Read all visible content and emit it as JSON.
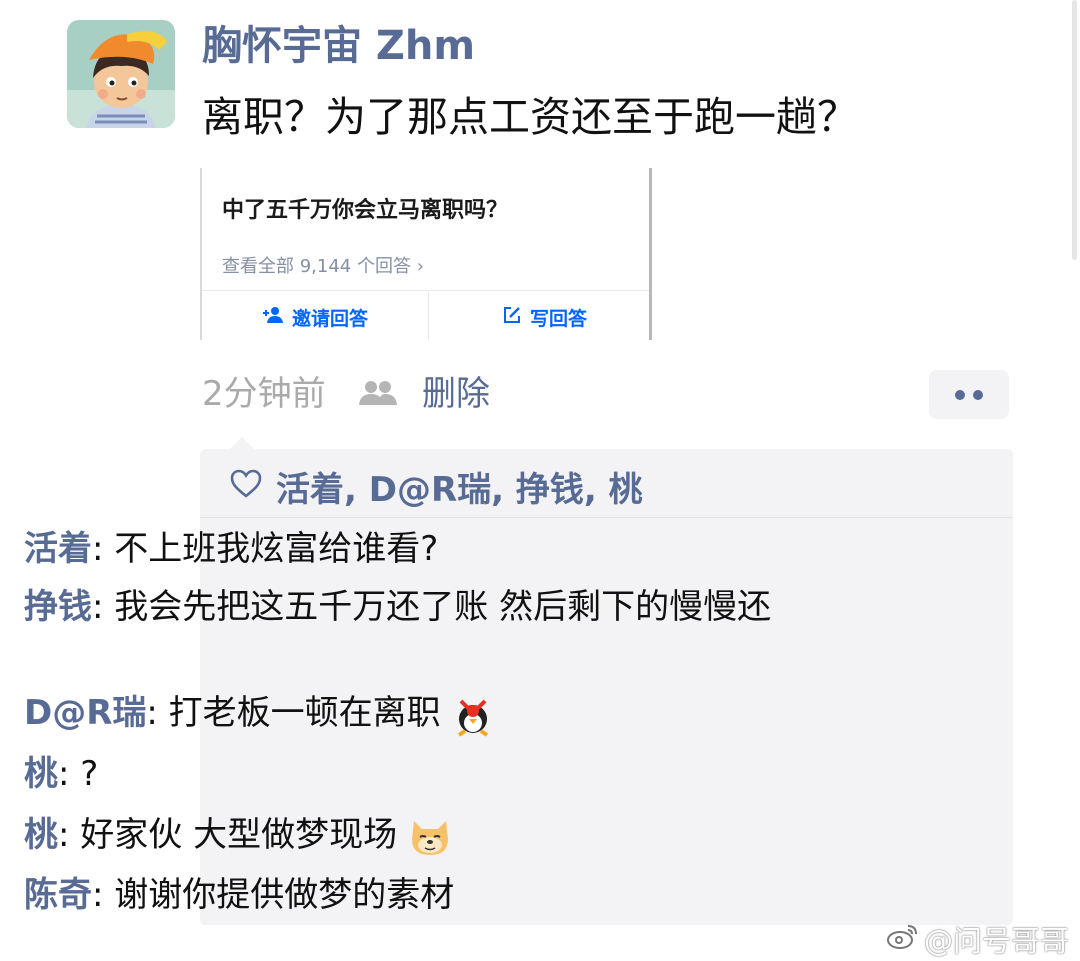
{
  "post": {
    "username": "胸怀宇宙 Zhm",
    "text": "离职？为了那点工资还至于跑一趟？",
    "time": "2分钟前",
    "delete_label": "删除"
  },
  "share_card": {
    "question": "中了五千万你会立马离职吗？",
    "view_all": "查看全部 9,144 个回答 ›",
    "invite_label": "邀请回答",
    "write_label": "写回答"
  },
  "likes": {
    "names": "活着, D@R瑞, 挣钱, 桃"
  },
  "comments": [
    {
      "author": "活着",
      "text": ": 不上班我炫富给谁看?"
    },
    {
      "author": "挣钱",
      "text": ": 我会先把这五千万还了账  然后剩下的慢慢还"
    },
    {
      "author": "D@R瑞",
      "text": ": 打老板一顿在离职"
    },
    {
      "author": "桃",
      "text": ": ?"
    },
    {
      "author": "桃",
      "text": ": 好家伙 大型做梦现场"
    },
    {
      "author": "陈奇",
      "text": ": 谢谢你提供做梦的素材"
    }
  ],
  "watermark": "@问号哥哥",
  "colors": {
    "link_blue": "#576b95",
    "zhihu_blue": "#0066ff",
    "comment_bg": "#f3f3f5"
  },
  "icons": {
    "friends": "friends-icon",
    "heart": "heart-outline-icon",
    "more": "more-dots-icon",
    "invite": "add-person-icon",
    "write": "edit-icon"
  }
}
